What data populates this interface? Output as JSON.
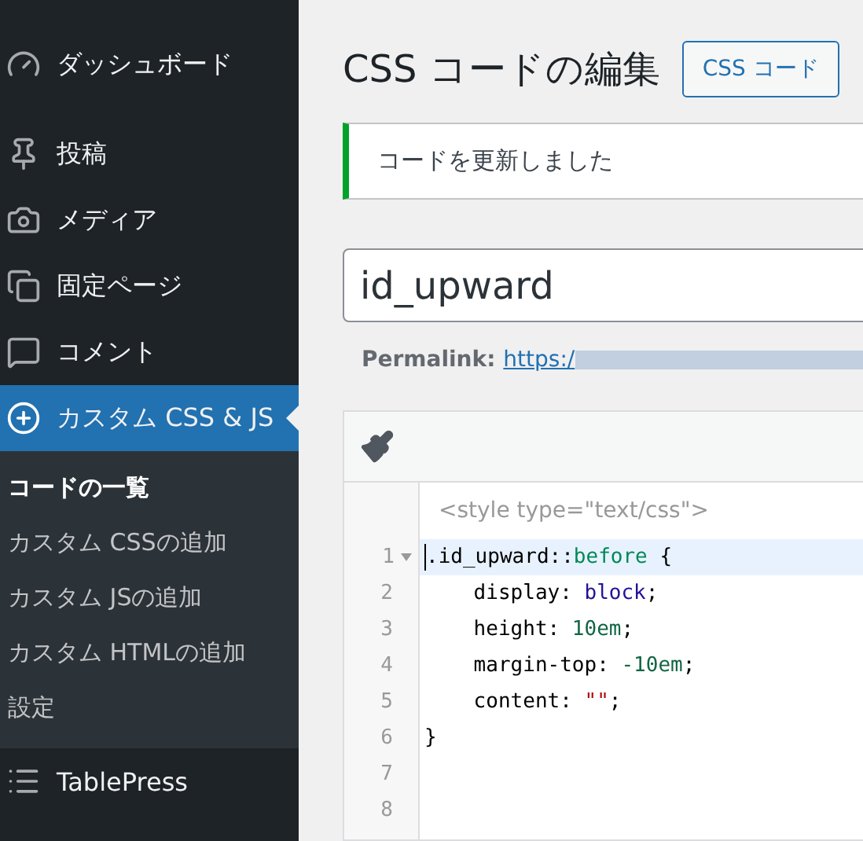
{
  "sidebar": {
    "items": [
      {
        "label": "ダッシュボード",
        "kind": "gauge",
        "selected": false
      },
      {
        "label": "投稿",
        "kind": "pin",
        "selected": false
      },
      {
        "label": "メディア",
        "kind": "media",
        "selected": false
      },
      {
        "label": "固定ページ",
        "kind": "pages",
        "selected": false
      },
      {
        "label": "コメント",
        "kind": "comment",
        "selected": false
      },
      {
        "label": "カスタム CSS & JS",
        "kind": "plus",
        "selected": true,
        "children": [
          {
            "label": "コードの一覧",
            "selected": true
          },
          {
            "label": "カスタム CSSの追加",
            "selected": false
          },
          {
            "label": "カスタム JSの追加",
            "selected": false
          },
          {
            "label": "カスタム HTMLの追加",
            "selected": false
          },
          {
            "label": "設定",
            "selected": false
          }
        ]
      },
      {
        "label": "TablePress",
        "kind": "list",
        "selected": false
      }
    ]
  },
  "main": {
    "title": "CSS コードの編集",
    "title_button": "CSS コード",
    "notice": "コードを更新しました",
    "title_field": {
      "value": "id_upward"
    },
    "permalink": {
      "label": "Permalink:",
      "link": "https:/"
    },
    "editor": {
      "header": "<style type=\"text/css\">",
      "lines": [
        {
          "number": "1",
          "active": true,
          "foldable": true,
          "tokens": [
            {
              "text": ".id_upward::",
              "kind": "plain"
            },
            {
              "text": "before",
              "kind": "keyword"
            },
            {
              "text": " {",
              "kind": "plain"
            }
          ]
        },
        {
          "number": "2",
          "active": false,
          "foldable": false,
          "tokens": [
            {
              "text": "    display: ",
              "kind": "plain"
            },
            {
              "text": "block",
              "kind": "value"
            },
            {
              "text": ";",
              "kind": "plain"
            }
          ]
        },
        {
          "number": "3",
          "active": false,
          "foldable": false,
          "tokens": [
            {
              "text": "    height: ",
              "kind": "plain"
            },
            {
              "text": "10em",
              "kind": "number"
            },
            {
              "text": ";",
              "kind": "plain"
            }
          ]
        },
        {
          "number": "4",
          "active": false,
          "foldable": false,
          "tokens": [
            {
              "text": "    margin-top: ",
              "kind": "plain"
            },
            {
              "text": "-10em",
              "kind": "number"
            },
            {
              "text": ";",
              "kind": "plain"
            }
          ]
        },
        {
          "number": "5",
          "active": false,
          "foldable": false,
          "tokens": [
            {
              "text": "    content: ",
              "kind": "plain"
            },
            {
              "text": "\"\"",
              "kind": "string"
            },
            {
              "text": ";",
              "kind": "plain"
            }
          ]
        },
        {
          "number": "6",
          "active": false,
          "foldable": false,
          "tokens": [
            {
              "text": "}",
              "kind": "plain"
            }
          ]
        },
        {
          "number": "7",
          "active": false,
          "foldable": false
        },
        {
          "number": "8",
          "active": false,
          "foldable": false
        }
      ]
    }
  }
}
